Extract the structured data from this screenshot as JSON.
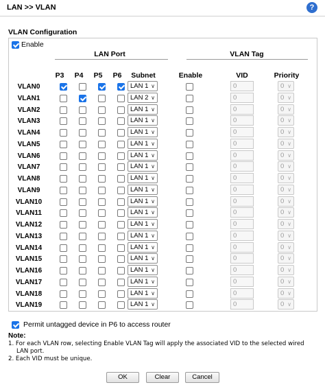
{
  "header": {
    "title": "LAN >> VLAN",
    "help_icon": "?"
  },
  "config": {
    "section_title": "VLAN Configuration",
    "enable_label": "Enable",
    "enable_checked": true,
    "group_lan_port": "LAN Port",
    "group_vlan_tag": "VLAN Tag",
    "columns": [
      "P3",
      "P4",
      "P5",
      "P6",
      "Subnet",
      "Enable",
      "VID",
      "Priority"
    ]
  },
  "vlans": [
    {
      "name": "VLAN0",
      "p3": true,
      "p4": false,
      "p5": true,
      "p6": true,
      "subnet": "LAN 1",
      "tag_enable": false,
      "vid": "0",
      "priority": "0"
    },
    {
      "name": "VLAN1",
      "p3": false,
      "p4": true,
      "p5": false,
      "p6": false,
      "subnet": "LAN 2",
      "tag_enable": false,
      "vid": "0",
      "priority": "0"
    },
    {
      "name": "VLAN2",
      "p3": false,
      "p4": false,
      "p5": false,
      "p6": false,
      "subnet": "LAN 1",
      "tag_enable": false,
      "vid": "0",
      "priority": "0"
    },
    {
      "name": "VLAN3",
      "p3": false,
      "p4": false,
      "p5": false,
      "p6": false,
      "subnet": "LAN 1",
      "tag_enable": false,
      "vid": "0",
      "priority": "0"
    },
    {
      "name": "VLAN4",
      "p3": false,
      "p4": false,
      "p5": false,
      "p6": false,
      "subnet": "LAN 1",
      "tag_enable": false,
      "vid": "0",
      "priority": "0"
    },
    {
      "name": "VLAN5",
      "p3": false,
      "p4": false,
      "p5": false,
      "p6": false,
      "subnet": "LAN 1",
      "tag_enable": false,
      "vid": "0",
      "priority": "0"
    },
    {
      "name": "VLAN6",
      "p3": false,
      "p4": false,
      "p5": false,
      "p6": false,
      "subnet": "LAN 1",
      "tag_enable": false,
      "vid": "0",
      "priority": "0"
    },
    {
      "name": "VLAN7",
      "p3": false,
      "p4": false,
      "p5": false,
      "p6": false,
      "subnet": "LAN 1",
      "tag_enable": false,
      "vid": "0",
      "priority": "0"
    },
    {
      "name": "VLAN8",
      "p3": false,
      "p4": false,
      "p5": false,
      "p6": false,
      "subnet": "LAN 1",
      "tag_enable": false,
      "vid": "0",
      "priority": "0"
    },
    {
      "name": "VLAN9",
      "p3": false,
      "p4": false,
      "p5": false,
      "p6": false,
      "subnet": "LAN 1",
      "tag_enable": false,
      "vid": "0",
      "priority": "0"
    },
    {
      "name": "VLAN10",
      "p3": false,
      "p4": false,
      "p5": false,
      "p6": false,
      "subnet": "LAN 1",
      "tag_enable": false,
      "vid": "0",
      "priority": "0"
    },
    {
      "name": "VLAN11",
      "p3": false,
      "p4": false,
      "p5": false,
      "p6": false,
      "subnet": "LAN 1",
      "tag_enable": false,
      "vid": "0",
      "priority": "0"
    },
    {
      "name": "VLAN12",
      "p3": false,
      "p4": false,
      "p5": false,
      "p6": false,
      "subnet": "LAN 1",
      "tag_enable": false,
      "vid": "0",
      "priority": "0"
    },
    {
      "name": "VLAN13",
      "p3": false,
      "p4": false,
      "p5": false,
      "p6": false,
      "subnet": "LAN 1",
      "tag_enable": false,
      "vid": "0",
      "priority": "0"
    },
    {
      "name": "VLAN14",
      "p3": false,
      "p4": false,
      "p5": false,
      "p6": false,
      "subnet": "LAN 1",
      "tag_enable": false,
      "vid": "0",
      "priority": "0"
    },
    {
      "name": "VLAN15",
      "p3": false,
      "p4": false,
      "p5": false,
      "p6": false,
      "subnet": "LAN 1",
      "tag_enable": false,
      "vid": "0",
      "priority": "0"
    },
    {
      "name": "VLAN16",
      "p3": false,
      "p4": false,
      "p5": false,
      "p6": false,
      "subnet": "LAN 1",
      "tag_enable": false,
      "vid": "0",
      "priority": "0"
    },
    {
      "name": "VLAN17",
      "p3": false,
      "p4": false,
      "p5": false,
      "p6": false,
      "subnet": "LAN 1",
      "tag_enable": false,
      "vid": "0",
      "priority": "0"
    },
    {
      "name": "VLAN18",
      "p3": false,
      "p4": false,
      "p5": false,
      "p6": false,
      "subnet": "LAN 1",
      "tag_enable": false,
      "vid": "0",
      "priority": "0"
    },
    {
      "name": "VLAN19",
      "p3": false,
      "p4": false,
      "p5": false,
      "p6": false,
      "subnet": "LAN 1",
      "tag_enable": false,
      "vid": "0",
      "priority": "0"
    }
  ],
  "permit": {
    "label": "Permit untagged device in P6 to access router",
    "checked": true
  },
  "note": {
    "title": "Note:",
    "line1": "1. For each VLAN row, selecting Enable VLAN Tag will apply the associated VID to the selected wired",
    "line1b": "LAN port.",
    "line2": "2. Each VID must be unique."
  },
  "buttons": {
    "ok": "OK",
    "clear": "Clear",
    "cancel": "Cancel"
  },
  "colors": {
    "accent": "#1a73e8",
    "help": "#2f6fcf"
  }
}
